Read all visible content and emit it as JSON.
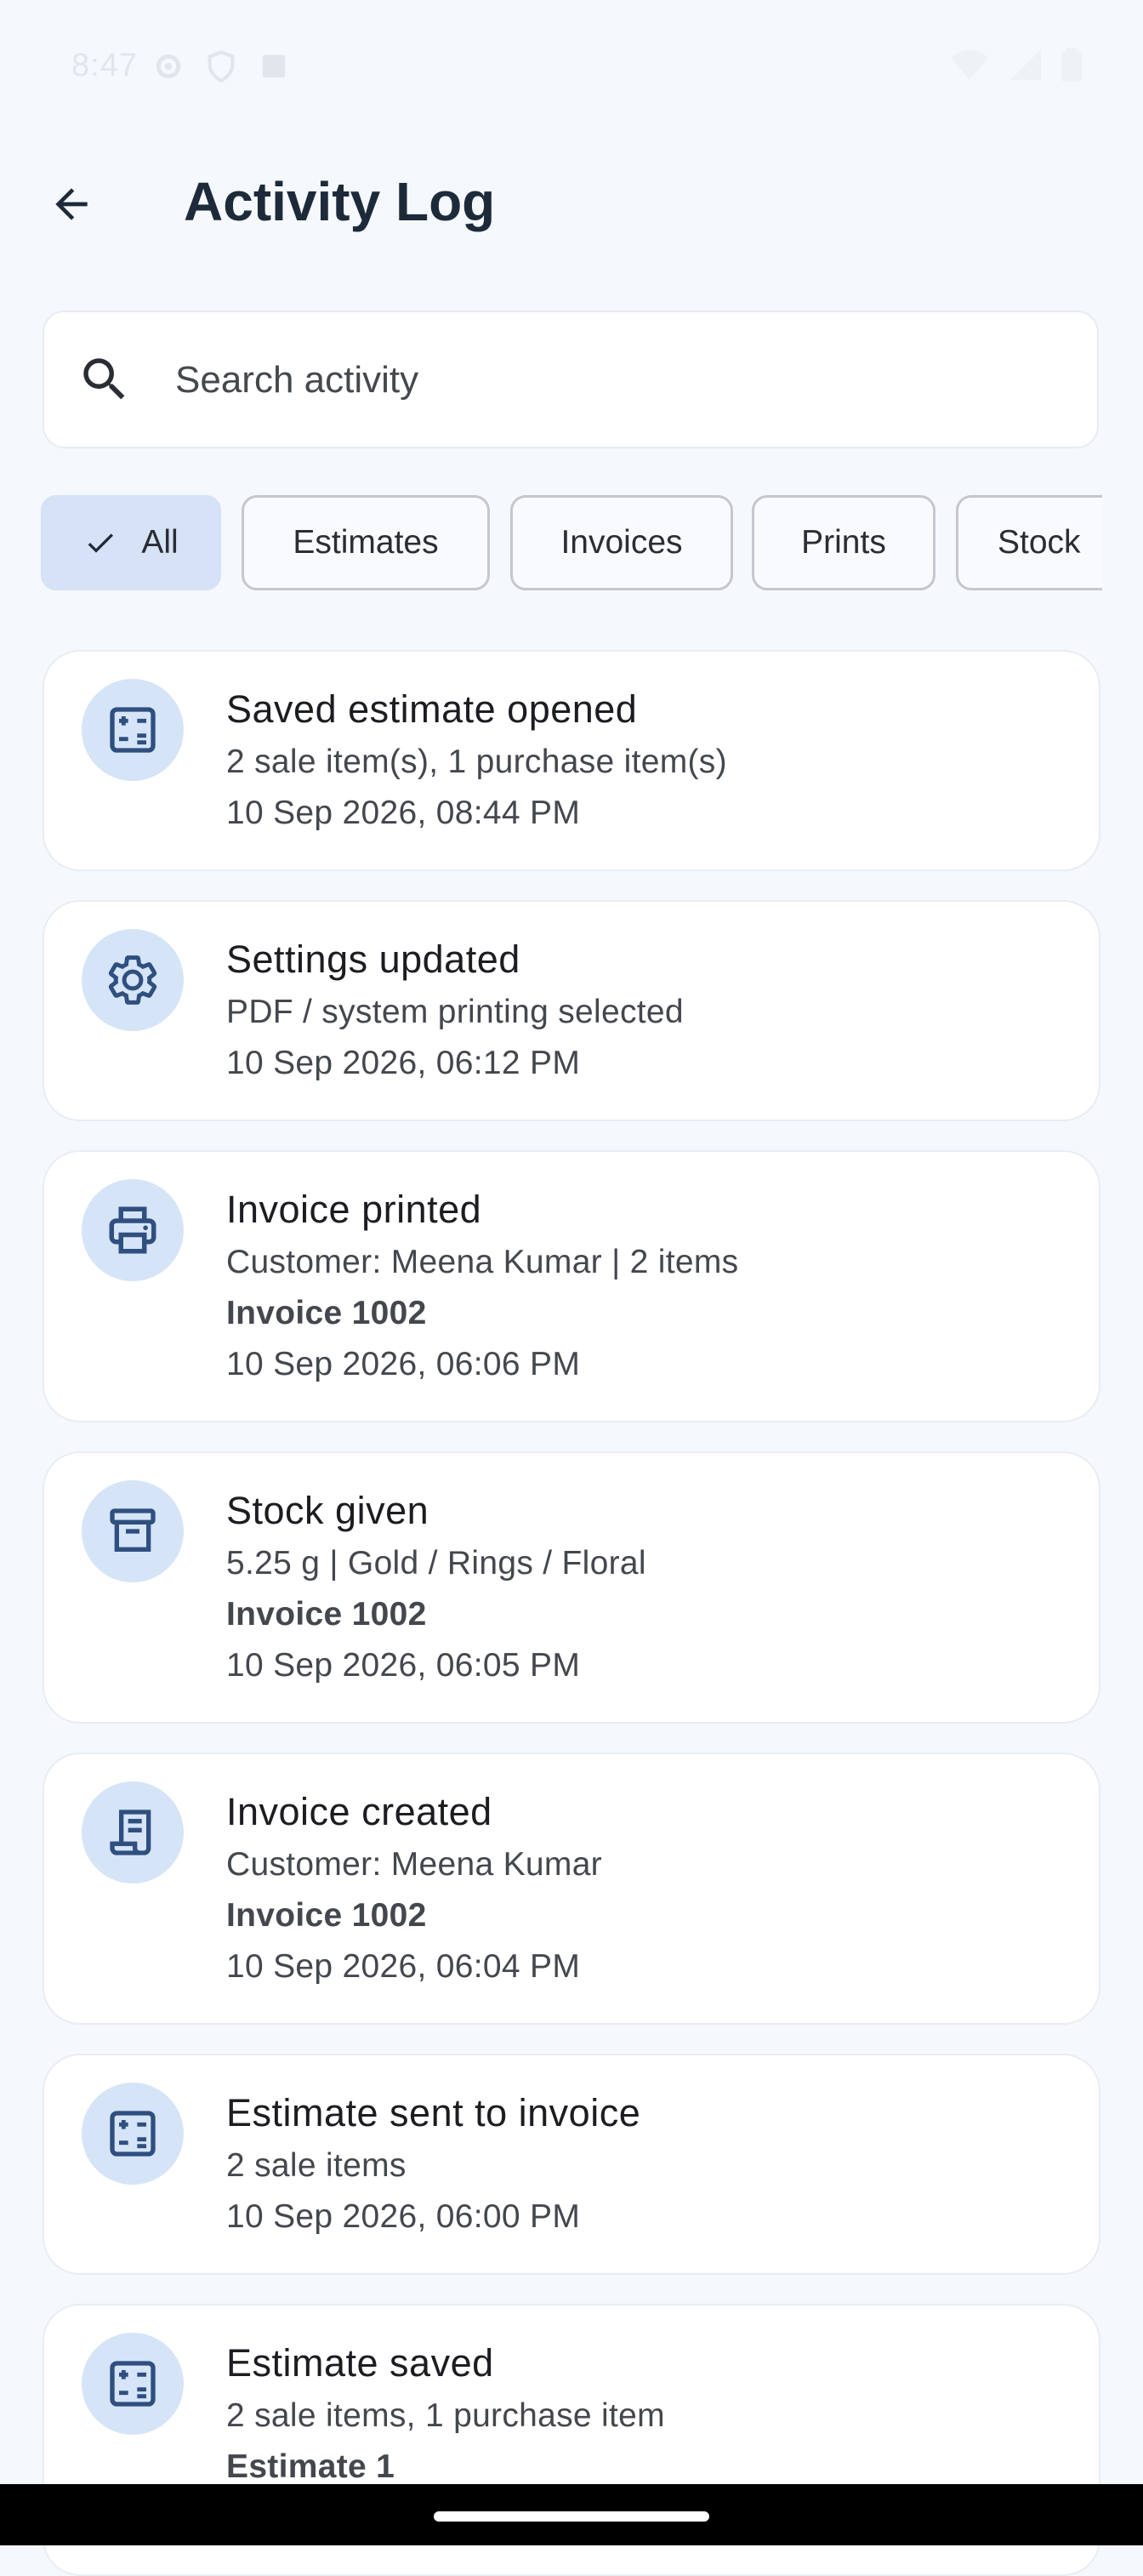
{
  "status_bar": {
    "time": "8:47"
  },
  "header": {
    "title": "Activity Log"
  },
  "search": {
    "placeholder": "Search activity",
    "value": ""
  },
  "filters": [
    {
      "label": "All",
      "selected": true
    },
    {
      "label": "Estimates",
      "selected": false
    },
    {
      "label": "Invoices",
      "selected": false
    },
    {
      "label": "Prints",
      "selected": false
    },
    {
      "label": "Stock",
      "selected": false
    }
  ],
  "activities": [
    {
      "icon": "calculator-icon",
      "title": "Saved estimate opened",
      "detail": "2 sale item(s), 1 purchase item(s)",
      "reference": "",
      "timestamp": "10 Sep 2026, 08:44 PM"
    },
    {
      "icon": "gear-icon",
      "title": "Settings updated",
      "detail": "PDF / system printing selected",
      "reference": "",
      "timestamp": "10 Sep 2026, 06:12 PM"
    },
    {
      "icon": "printer-icon",
      "title": "Invoice printed",
      "detail": "Customer: Meena Kumar | 2 items",
      "reference": "Invoice 1002",
      "timestamp": "10 Sep 2026, 06:06 PM"
    },
    {
      "icon": "archive-box-icon",
      "title": "Stock given",
      "detail": "5.25 g | Gold / Rings / Floral",
      "reference": "Invoice 1002",
      "timestamp": "10 Sep 2026, 06:05 PM"
    },
    {
      "icon": "receipt-icon",
      "title": "Invoice created",
      "detail": "Customer: Meena Kumar",
      "reference": "Invoice 1002",
      "timestamp": "10 Sep 2026, 06:04 PM"
    },
    {
      "icon": "calculator-icon",
      "title": "Estimate sent to invoice",
      "detail": "2 sale items",
      "reference": "",
      "timestamp": "10 Sep 2026, 06:00 PM"
    },
    {
      "icon": "calculator-icon",
      "title": "Estimate saved",
      "detail": "2 sale items, 1 purchase item",
      "reference": "Estimate 1",
      "timestamp": ""
    }
  ],
  "colors": {
    "accent": "#2f4f7f",
    "icon_bg": "#d6e4f8",
    "chip_selected": "#d6e2f6"
  }
}
